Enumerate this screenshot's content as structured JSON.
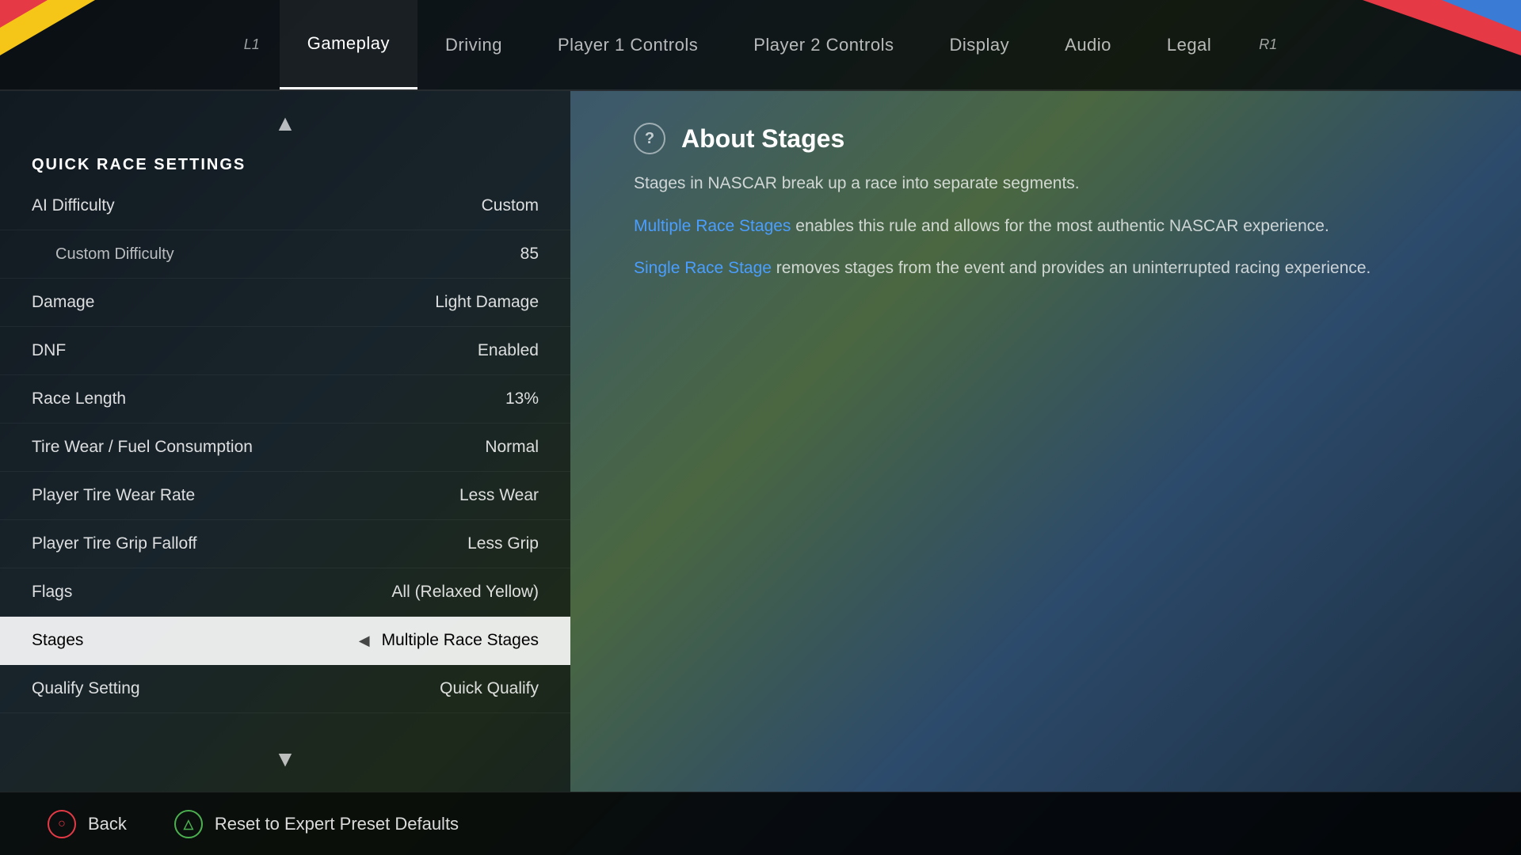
{
  "background": {
    "color": "#2c3e50"
  },
  "nav": {
    "l1_label": "L1",
    "r1_label": "R1",
    "tabs": [
      {
        "id": "gameplay",
        "label": "Gameplay",
        "active": true
      },
      {
        "id": "driving",
        "label": "Driving",
        "active": false
      },
      {
        "id": "player1controls",
        "label": "Player 1 Controls",
        "active": false
      },
      {
        "id": "player2controls",
        "label": "Player 2 Controls",
        "active": false
      },
      {
        "id": "display",
        "label": "Display",
        "active": false
      },
      {
        "id": "audio",
        "label": "Audio",
        "active": false
      },
      {
        "id": "legal",
        "label": "Legal",
        "active": false
      }
    ]
  },
  "settings_panel": {
    "section_title": "QUICK RACE SETTINGS",
    "scroll_up": "▲",
    "scroll_down": "▼",
    "rows": [
      {
        "id": "ai-difficulty",
        "name": "AI Difficulty",
        "value": "Custom",
        "indented": false,
        "active": false
      },
      {
        "id": "custom-difficulty",
        "name": "Custom Difficulty",
        "value": "85",
        "indented": true,
        "active": false
      },
      {
        "id": "damage",
        "name": "Damage",
        "value": "Light Damage",
        "indented": false,
        "active": false
      },
      {
        "id": "dnf",
        "name": "DNF",
        "value": "Enabled",
        "indented": false,
        "active": false
      },
      {
        "id": "race-length",
        "name": "Race Length",
        "value": "13%",
        "indented": false,
        "active": false
      },
      {
        "id": "tire-wear",
        "name": "Tire Wear / Fuel Consumption",
        "value": "Normal",
        "indented": false,
        "active": false
      },
      {
        "id": "player-tire-wear-rate",
        "name": "Player Tire Wear Rate",
        "value": "Less Wear",
        "indented": false,
        "active": false
      },
      {
        "id": "player-tire-grip",
        "name": "Player Tire Grip Falloff",
        "value": "Less Grip",
        "indented": false,
        "active": false
      },
      {
        "id": "flags",
        "name": "Flags",
        "value": "All (Relaxed Yellow)",
        "indented": false,
        "active": false
      },
      {
        "id": "stages",
        "name": "Stages",
        "value": "Multiple Race Stages",
        "indented": false,
        "active": true
      },
      {
        "id": "qualify-setting",
        "name": "Qualify Setting",
        "value": "Quick Qualify",
        "indented": false,
        "active": false
      }
    ]
  },
  "info_panel": {
    "icon": "?",
    "title": "About Stages",
    "paragraphs": [
      {
        "text": "Stages in NASCAR break up a race into separate segments."
      },
      {
        "prefix": "",
        "link_text": "Multiple Race Stages",
        "suffix": " enables this rule and allows for the most authentic NASCAR experience."
      },
      {
        "prefix": "",
        "link_text": "Single Race Stage",
        "suffix": " removes stages from the event and provides an uninterrupted racing experience."
      }
    ]
  },
  "bottom_bar": {
    "back_icon": "○",
    "back_label": "Back",
    "reset_icon": "△",
    "reset_label": "Reset to Expert Preset Defaults"
  }
}
